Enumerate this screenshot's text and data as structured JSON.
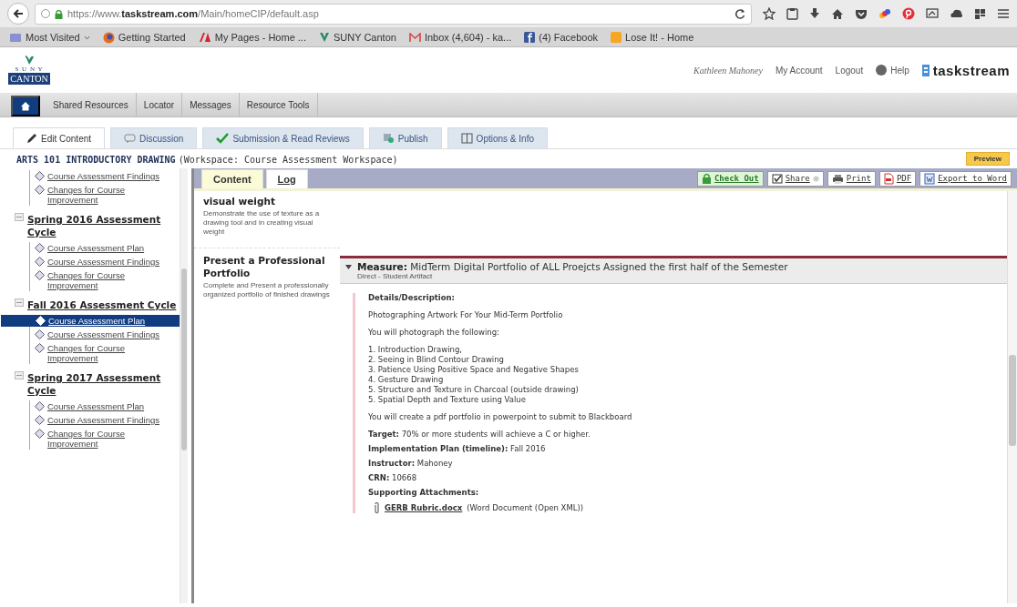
{
  "browser": {
    "url": "https://www.**taskstream.com**/Main/homeCIP/default.asp",
    "bookmarks": [
      {
        "label": "Most Visited",
        "kind": "folder"
      },
      {
        "label": "Getting Started",
        "kind": "firefox"
      },
      {
        "label": "My Pages - Home ...",
        "kind": "pages"
      },
      {
        "label": "SUNY Canton",
        "kind": "suny"
      },
      {
        "label": "Inbox (4,604) - ka...",
        "kind": "mail"
      },
      {
        "label": "(4) Facebook",
        "kind": "facebook"
      },
      {
        "label": "Lose It! - Home",
        "kind": "loseit"
      }
    ]
  },
  "header": {
    "logo_top": "S U N Y",
    "logo_bottom": "CANTON",
    "user": "Kathleen Mahoney",
    "links": [
      "My Account",
      "Logout"
    ],
    "help": "Help",
    "brand": "taskstream"
  },
  "nav": {
    "items": [
      "Shared Resources",
      "Locator",
      "Messages",
      "Resource Tools"
    ]
  },
  "tabs": [
    {
      "label": "Edit Content",
      "kind": "edit",
      "selected": true
    },
    {
      "label": "Discussion",
      "kind": "discussion",
      "selected": false
    },
    {
      "label": "Submission & Read Reviews",
      "kind": "check",
      "selected": false
    },
    {
      "label": "Publish",
      "kind": "publish",
      "selected": false
    },
    {
      "label": "Options & Info",
      "kind": "info",
      "selected": false
    }
  ],
  "title": {
    "course": "ARTS 101 INTRODUCTORY DRAWING",
    "workspace": "(Workspace: Course Assessment Workspace)",
    "preview": "Preview"
  },
  "sidebar": {
    "groups": [
      {
        "children": [
          {
            "label": "Course Assessment Findings",
            "selected": false
          },
          {
            "label": "Changes for Course Improvement",
            "selected": false
          }
        ]
      },
      {
        "title": "Spring 2016 Assessment Cycle",
        "children": [
          {
            "label": "Course Assessment Plan",
            "selected": false
          },
          {
            "label": "Course Assessment Findings",
            "selected": false
          },
          {
            "label": "Changes for Course Improvement",
            "selected": false
          }
        ]
      },
      {
        "title": "Fall 2016 Assessment Cycle",
        "children": [
          {
            "label": "Course Assessment Plan",
            "selected": true
          },
          {
            "label": "Course Assessment Findings",
            "selected": false
          },
          {
            "label": "Changes for Course Improvement",
            "selected": false
          }
        ]
      },
      {
        "title": "Spring 2017 Assessment Cycle",
        "children": [
          {
            "label": "Course Assessment Plan",
            "selected": false
          },
          {
            "label": "Course Assessment Findings",
            "selected": false
          },
          {
            "label": "Changes for Course Improvement",
            "selected": false
          }
        ]
      }
    ]
  },
  "panel": {
    "tabs": [
      {
        "label": "Content",
        "selected": true
      },
      {
        "label": "Log",
        "selected": false
      }
    ],
    "actions": [
      {
        "label": "Check Out",
        "kind": "checkout"
      },
      {
        "label": "Share",
        "kind": "share"
      },
      {
        "label": "Print",
        "kind": "print"
      },
      {
        "label": "PDF",
        "kind": "pdf"
      },
      {
        "label": "Export to Word",
        "kind": "word"
      }
    ],
    "outcomes": [
      {
        "title": "visual weight",
        "description": "Demonstrate the use of texture as a drawing tool and in creating visual weight"
      },
      {
        "title": "Present a Professional Portfolio",
        "description": "Complete and Present a professionally organized portfolio of finished drawings"
      }
    ],
    "measure": {
      "label": "Measure:",
      "title": "MidTerm Digital Portfolio of ALL Proejcts Assigned the first half of the Semester",
      "subtitle": "Direct - Student Artifact",
      "expanded": true,
      "details_heading": "Details/Description:",
      "paragraphs": [
        "Photographing Artwork For Your Mid-Term Portfolio",
        "You will photograph the following:"
      ],
      "list": [
        "1. Introduction Drawing,",
        "2. Seeing in Blind Contour Drawing",
        "3. Patience Using Positive Space and Negative Shapes",
        "4. Gesture Drawing",
        "5. Structure and Texture in Charcoal (outside drawing)",
        "5. Spatial Depth and Texture using Value"
      ],
      "closing": "You will create a pdf portfolio in powerpoint to submit to Blackboard",
      "fields": [
        "**Target:** 70% or more students will achieve a C or higher.",
        "**Implementation Plan (timeline):** Fall 2016",
        "**Instructor:** Mahoney",
        "**CRN:** 10668"
      ],
      "attachments_heading": "Supporting Attachments:",
      "attachment": {
        "name": "GERB Rubric.docx",
        "type": "(Word Document (Open XML))"
      }
    }
  }
}
